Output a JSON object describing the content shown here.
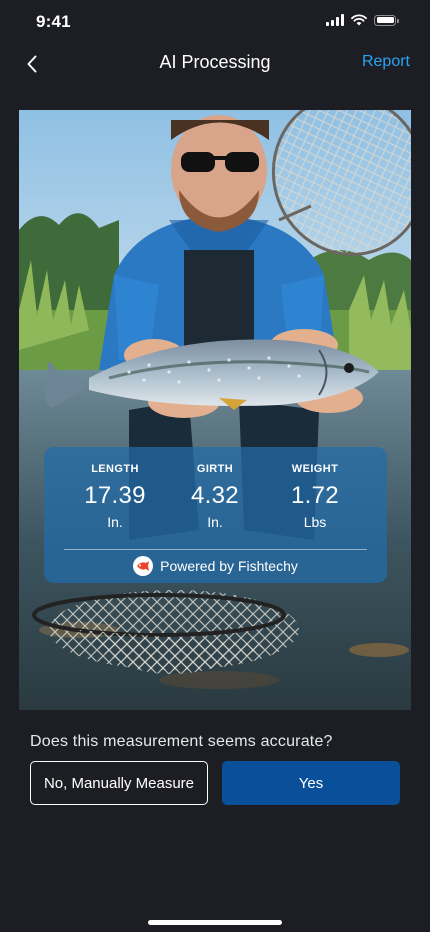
{
  "status_bar": {
    "time": "9:41"
  },
  "nav": {
    "title": "AI Processing",
    "report_label": "Report"
  },
  "measurements": [
    {
      "label": "LENGTH",
      "value": "17.39",
      "unit": "In."
    },
    {
      "label": "GIRTH",
      "value": "4.32",
      "unit": "In."
    },
    {
      "label": "WEIGHT",
      "value": "1.72",
      "unit": "Lbs"
    }
  ],
  "powered_by": "Powered by Fishtechy",
  "prompt": {
    "question": "Does this measurement seems accurate?",
    "manual_label": "No, Manually Measure",
    "yes_label": "Yes"
  },
  "colors": {
    "background": "#1c1e24",
    "accent": "#2aa3f2",
    "primary_button": "#0a4f9a"
  }
}
